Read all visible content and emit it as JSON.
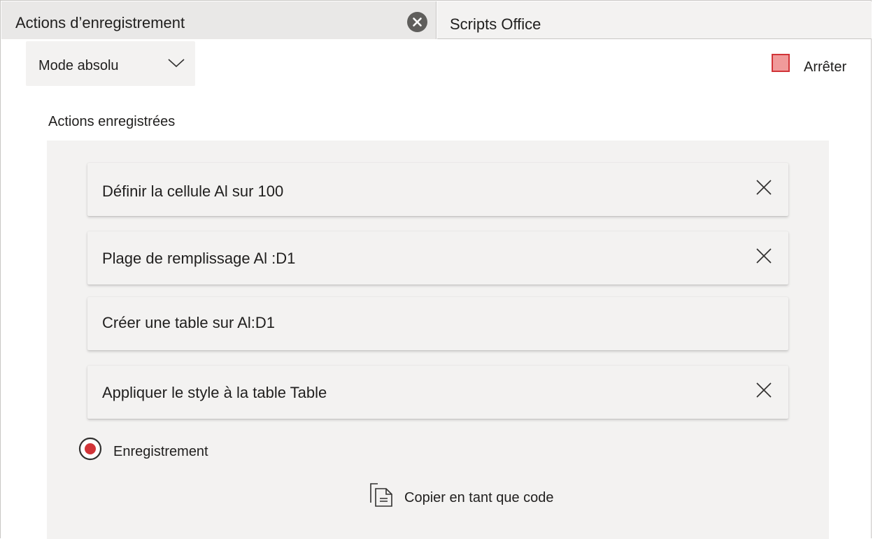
{
  "tabs": [
    {
      "label": "Actions d’enregistrement",
      "active": true
    },
    {
      "label": "Scripts Office",
      "active": false
    }
  ],
  "toolbar": {
    "mode_label": "Mode absolu",
    "stop_label": "Arrêter"
  },
  "recorded": {
    "title": "Actions enregistrées",
    "actions": [
      {
        "text": "Définir la cellule Al sur 100",
        "removable": true
      },
      {
        "text": "Plage de remplissage Al :D1",
        "removable": true
      },
      {
        "text": "Créer une table sur Al:D1",
        "removable": false
      },
      {
        "text": "Appliquer le style à la table Table",
        "removable": true
      }
    ],
    "status_label": "Enregistrement",
    "copy_label": "Copier en tant que code"
  },
  "colors": {
    "accent_record": "#d13438",
    "stop_fill": "#f09a9a",
    "panel_bg": "#f3f2f1"
  },
  "icons": {
    "tab_close": "close-circle-icon",
    "mode": "chevron-down-icon",
    "stop": "stop-square-icon",
    "remove": "close-icon",
    "record": "record-icon",
    "copy": "copy-document-icon"
  }
}
